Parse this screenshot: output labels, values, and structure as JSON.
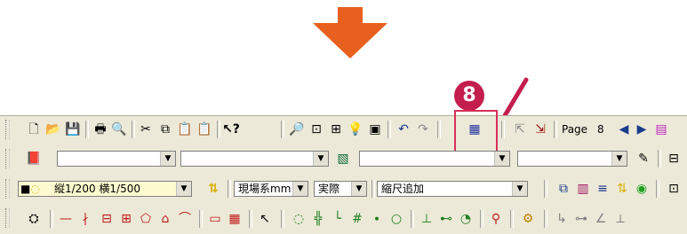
{
  "step": {
    "badge_number": "8",
    "arrow_color": "#e8601e",
    "highlight_color": "#c41e4e"
  },
  "toolbar1": {
    "page_label": "Page",
    "page_number": "8",
    "icons": [
      "new-document-icon",
      "open-folder-icon",
      "save-icon",
      "print-icon",
      "print-preview-icon",
      "cut-icon",
      "copy-icon",
      "paste-icon",
      "paste-special-icon",
      "help-pointer-icon",
      "zoom-icon",
      "zoom-window-icon",
      "zoom-all-icon",
      "light-bulb-icon",
      "zoom-extent-icon",
      "undo-icon",
      "redo-icon",
      "target-tool-icon",
      "export-icon",
      "import-icon",
      "prev-page-icon",
      "next-page-icon"
    ]
  },
  "toolbar2": {
    "field1_value": "",
    "field2_value": "",
    "field3_value": "",
    "field4_value": "",
    "field5_value": ""
  },
  "toolbar3": {
    "layer_value": "縦1/200 横1/500",
    "coord_value": "現場系mm",
    "mode_value": "実際",
    "scale_value": "縮尺追加"
  }
}
